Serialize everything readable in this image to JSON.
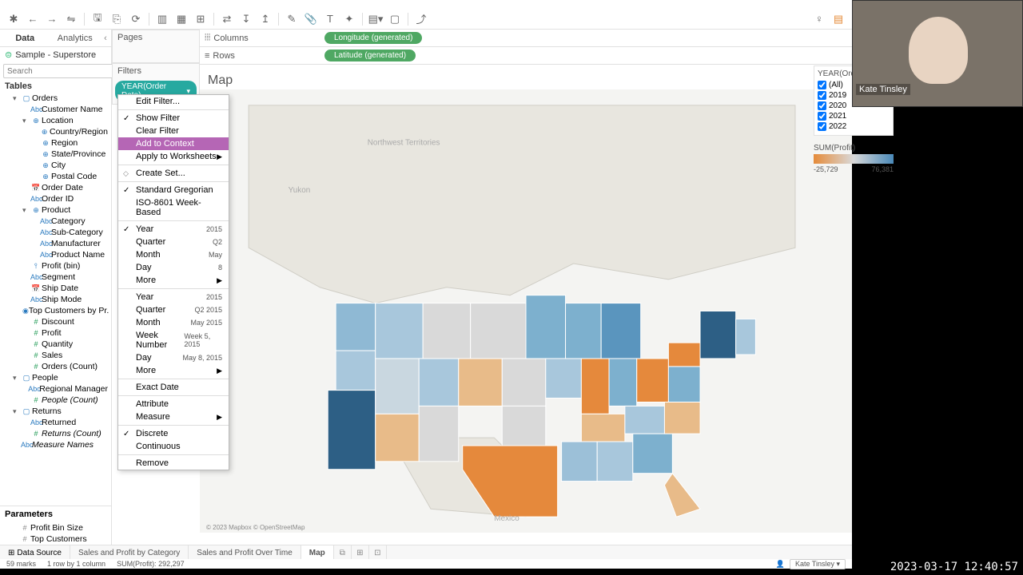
{
  "toolbar": {
    "icons": [
      "⊞",
      "←",
      "→",
      "⟲",
      "💾",
      "⎘",
      "⎋",
      "↻",
      "|",
      "📊",
      "▦",
      "🗺",
      "|",
      "⇄",
      "⊟",
      "⊞",
      "|",
      "✎",
      "📎",
      "T",
      "✦",
      "|",
      "▤",
      "▢",
      "|",
      "⤴"
    ]
  },
  "leftPanel": {
    "tabs": [
      "Data",
      "Analytics"
    ],
    "datasource": "Sample - Superstore",
    "searchPlaceholder": "Search",
    "tablesLabel": "Tables",
    "paramsLabel": "Parameters",
    "params": [
      "Profit Bin Size",
      "Top Customers"
    ],
    "tree": [
      {
        "t": "tbl",
        "l": "Orders",
        "i": 1,
        "tog": "▾"
      },
      {
        "t": "str",
        "l": "Customer Name",
        "i": 2,
        "ic": "Abc"
      },
      {
        "t": "geo",
        "l": "Location",
        "i": 2,
        "tog": "▾",
        "ic": "⊕"
      },
      {
        "t": "geo",
        "l": "Country/Region",
        "i": 3,
        "ic": "⊕"
      },
      {
        "t": "geo",
        "l": "Region",
        "i": 3,
        "ic": "⊕"
      },
      {
        "t": "geo",
        "l": "State/Province",
        "i": 3,
        "ic": "⊕"
      },
      {
        "t": "geo",
        "l": "City",
        "i": 3,
        "ic": "⊕"
      },
      {
        "t": "geo",
        "l": "Postal Code",
        "i": 3,
        "ic": "⊕"
      },
      {
        "t": "date",
        "l": "Order Date",
        "i": 2,
        "ic": "📅"
      },
      {
        "t": "str",
        "l": "Order ID",
        "i": 2,
        "ic": "Abc"
      },
      {
        "t": "hier",
        "l": "Product",
        "i": 2,
        "tog": "▾",
        "ic": "⊕"
      },
      {
        "t": "str",
        "l": "Category",
        "i": 3,
        "ic": "Abc"
      },
      {
        "t": "str",
        "l": "Sub-Category",
        "i": 3,
        "ic": "Abc"
      },
      {
        "t": "str",
        "l": "Manufacturer",
        "i": 3,
        "ic": "Abc"
      },
      {
        "t": "str",
        "l": "Product Name",
        "i": 3,
        "ic": "Abc"
      },
      {
        "t": "num",
        "l": "Profit (bin)",
        "i": 2,
        "ic": "⫯"
      },
      {
        "t": "str",
        "l": "Segment",
        "i": 2,
        "ic": "Abc"
      },
      {
        "t": "date",
        "l": "Ship Date",
        "i": 2,
        "ic": "📅"
      },
      {
        "t": "str",
        "l": "Ship Mode",
        "i": 2,
        "ic": "Abc"
      },
      {
        "t": "set",
        "l": "Top Customers by Pr...",
        "i": 2,
        "ic": "◉"
      },
      {
        "t": "mnum",
        "l": "Discount",
        "i": 2,
        "ic": "#"
      },
      {
        "t": "mnum",
        "l": "Profit",
        "i": 2,
        "ic": "#"
      },
      {
        "t": "mnum",
        "l": "Quantity",
        "i": 2,
        "ic": "#"
      },
      {
        "t": "mnum",
        "l": "Sales",
        "i": 2,
        "ic": "#"
      },
      {
        "t": "mnum",
        "l": "Orders (Count)",
        "i": 2,
        "ic": "#"
      },
      {
        "t": "tbl",
        "l": "People",
        "i": 1,
        "tog": "▾"
      },
      {
        "t": "str",
        "l": "Regional Manager",
        "i": 2,
        "ic": "Abc"
      },
      {
        "t": "mnum",
        "l": "People (Count)",
        "i": 2,
        "ic": "#",
        "italic": true
      },
      {
        "t": "tbl",
        "l": "Returns",
        "i": 1,
        "tog": "▾"
      },
      {
        "t": "str",
        "l": "Returned",
        "i": 2,
        "ic": "Abc"
      },
      {
        "t": "mnum",
        "l": "Returns (Count)",
        "i": 2,
        "ic": "#",
        "italic": true
      },
      {
        "t": "calc",
        "l": "Measure Names",
        "i": 1,
        "ic": "Abc",
        "italic": true
      }
    ]
  },
  "shelves": {
    "pages": "Pages",
    "filters": "Filters",
    "filterPill": "YEAR(Order Date)",
    "columns": "Columns",
    "rows": "Rows",
    "colPill": "Longitude (generated)",
    "rowPill": "Latitude (generated)"
  },
  "contextMenu": {
    "items": [
      {
        "l": "Edit Filter..."
      },
      {
        "sep": true
      },
      {
        "l": "Show Filter",
        "chk": true
      },
      {
        "l": "Clear Filter"
      },
      {
        "l": "Add to Context",
        "hl": true
      },
      {
        "l": "Apply to Worksheets",
        "sub": "▶"
      },
      {
        "sep": true
      },
      {
        "l": "Create Set...",
        "icon": true
      },
      {
        "sep": true
      },
      {
        "l": "Standard Gregorian",
        "chk": true
      },
      {
        "l": "ISO-8601 Week-Based"
      },
      {
        "sep": true
      },
      {
        "l": "Year",
        "r": "2015",
        "chk": true
      },
      {
        "l": "Quarter",
        "r": "Q2"
      },
      {
        "l": "Month",
        "r": "May"
      },
      {
        "l": "Day",
        "r": "8"
      },
      {
        "l": "More",
        "sub": "▶"
      },
      {
        "sep": true
      },
      {
        "l": "Year",
        "r": "2015"
      },
      {
        "l": "Quarter",
        "r": "Q2 2015"
      },
      {
        "l": "Month",
        "r": "May 2015"
      },
      {
        "l": "Week Number",
        "r": "Week 5, 2015"
      },
      {
        "l": "Day",
        "r": "May 8, 2015"
      },
      {
        "l": "More",
        "sub": "▶"
      },
      {
        "sep": true
      },
      {
        "l": "Exact Date"
      },
      {
        "sep": true
      },
      {
        "l": "Attribute"
      },
      {
        "l": "Measure",
        "sub": "▶"
      },
      {
        "sep": true
      },
      {
        "l": "Discrete",
        "chk": true
      },
      {
        "l": "Continuous"
      },
      {
        "sep": true
      },
      {
        "l": "Remove"
      }
    ]
  },
  "view": {
    "title": "Map",
    "attribution": "© 2023 Mapbox © OpenStreetMap",
    "labels": [
      "Yukon",
      "Northwest Territories",
      "Mexico"
    ]
  },
  "rightFilter": {
    "title": "YEAR(Order D",
    "options": [
      "(All)",
      "2019",
      "2020",
      "2021",
      "2022"
    ]
  },
  "legend": {
    "title": "SUM(Profit)",
    "min": "-25,729",
    "max": "76,381"
  },
  "sheetTabs": {
    "dataSource": "Data Source",
    "tabs": [
      "Sales and Profit by Category",
      "Sales and Profit Over Time",
      "Map"
    ],
    "active": 2
  },
  "status": {
    "marks": "59 marks",
    "rowcol": "1 row by 1 column",
    "sum": "SUM(Profit): 292,297",
    "user": "Kate Tinsley"
  },
  "overlay": {
    "name": "Kate Tinsley",
    "timestamp": "2023-03-17 12:40:57"
  }
}
